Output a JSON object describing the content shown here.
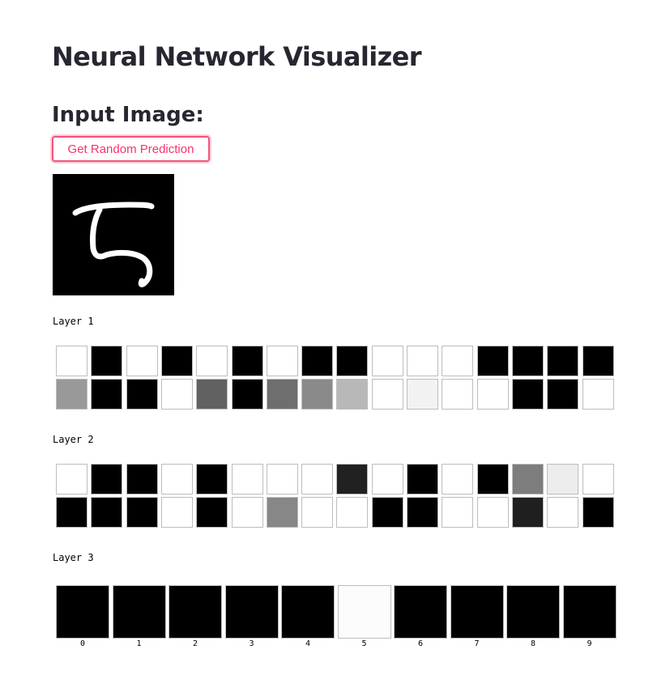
{
  "page": {
    "title": "Neural Network Visualizer",
    "subheader": "Input Image:",
    "button_label": "Get Random Prediction"
  },
  "colors": {
    "accent": "#f63366",
    "text": "#262730"
  },
  "input_image": {
    "description_icon": "handwritten-digit-image",
    "background": "#000000",
    "stroke": "#ffffff"
  },
  "layers": [
    {
      "label": "Layer 1",
      "rows": [
        [
          1,
          0,
          1,
          0,
          1,
          0,
          1,
          0,
          0,
          1,
          1,
          1,
          0,
          0,
          0,
          0
        ],
        [
          0.6,
          0,
          0,
          1,
          0.38,
          0,
          0.43,
          0.54,
          0.72,
          1,
          0.95,
          1,
          1,
          0,
          0,
          1
        ]
      ]
    },
    {
      "label": "Layer 2",
      "rows": [
        [
          1,
          0,
          0,
          1,
          0,
          1,
          1,
          1,
          0.13,
          1,
          0,
          1,
          0,
          0.49,
          0.93,
          1
        ],
        [
          0,
          0,
          0,
          1,
          0,
          1,
          0.53,
          1,
          1,
          0,
          0,
          1,
          1,
          0.12,
          1,
          0
        ]
      ]
    }
  ],
  "output_layer": {
    "label": "Layer 3",
    "classes": [
      "0",
      "1",
      "2",
      "3",
      "4",
      "5",
      "6",
      "7",
      "8",
      "9"
    ],
    "values": [
      0,
      0,
      0,
      0,
      0,
      0.99,
      0,
      0,
      0,
      0
    ]
  }
}
